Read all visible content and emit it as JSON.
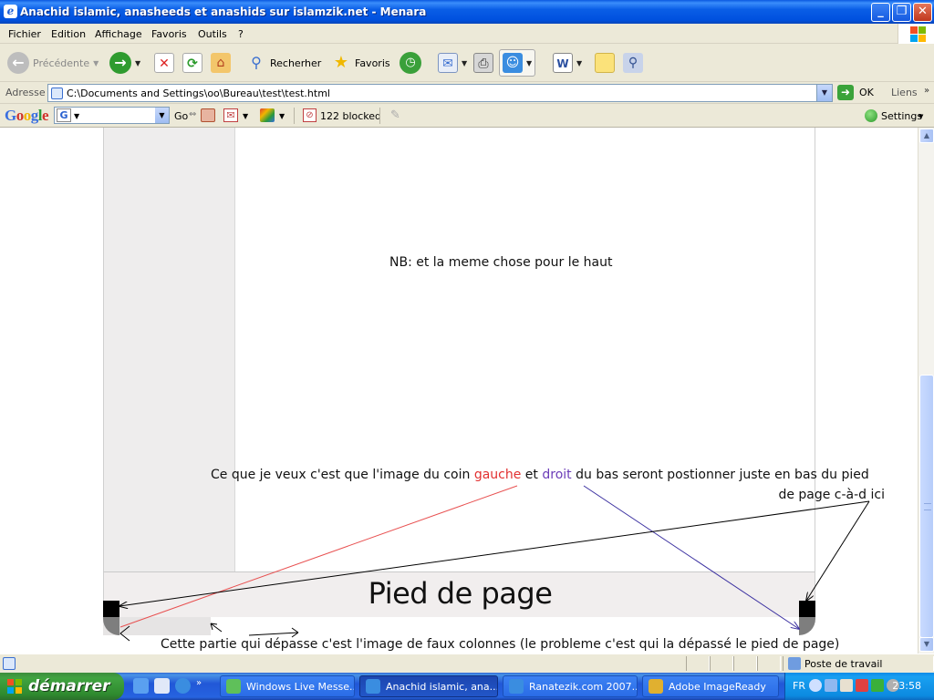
{
  "window": {
    "title": "Anachid islamic, anasheeds et anashids sur islamzik.net - Menara",
    "buttons": {
      "minimize": "_",
      "maximize": "❐",
      "close": "✕"
    }
  },
  "menu": [
    "Fichier",
    "Edition",
    "Affichage",
    "Favoris",
    "Outils",
    "?"
  ],
  "toolbar": {
    "back_label": "Précédente",
    "search_label": "Recherher",
    "favorites_label": "Favoris"
  },
  "address": {
    "label": "Adresse",
    "value": "C:\\Documents and Settings\\oo\\Bureau\\test\\test.html",
    "go_label": "OK",
    "links_label": "Liens"
  },
  "google": {
    "logo": "Google",
    "go_label": "Go",
    "blocked_label": "122 blocked",
    "settings_label": "Settings"
  },
  "content": {
    "nb_text": "NB: et la meme chose pour le haut",
    "explain_pre": "Ce  que je veux c'est  que l'image du coin ",
    "explain_left": "gauche",
    "explain_mid": " et ",
    "explain_right": "droit",
    "explain_post": " du bas seront postionner juste en bas du pied",
    "explain_line2": "de page c-à-d ici",
    "footer_title": "Pied de page",
    "bottom_note": "Cette partie qui dépasse c'est l'image de faux colonnes (le probleme c'est qui la dépassé le pied de page)"
  },
  "colors": {
    "left_word": "#e23030",
    "right_word": "#6b3cb8"
  },
  "statusbar": {
    "zone_label": "Poste de travail"
  },
  "taskbar": {
    "start_label": "démarrer",
    "tasks": [
      "Windows Live Messe...",
      "Anachid islamic, ana...",
      "Ranatezik.com  2007...",
      "Adobe ImageReady"
    ],
    "lang": "FR",
    "time": "23:58"
  }
}
